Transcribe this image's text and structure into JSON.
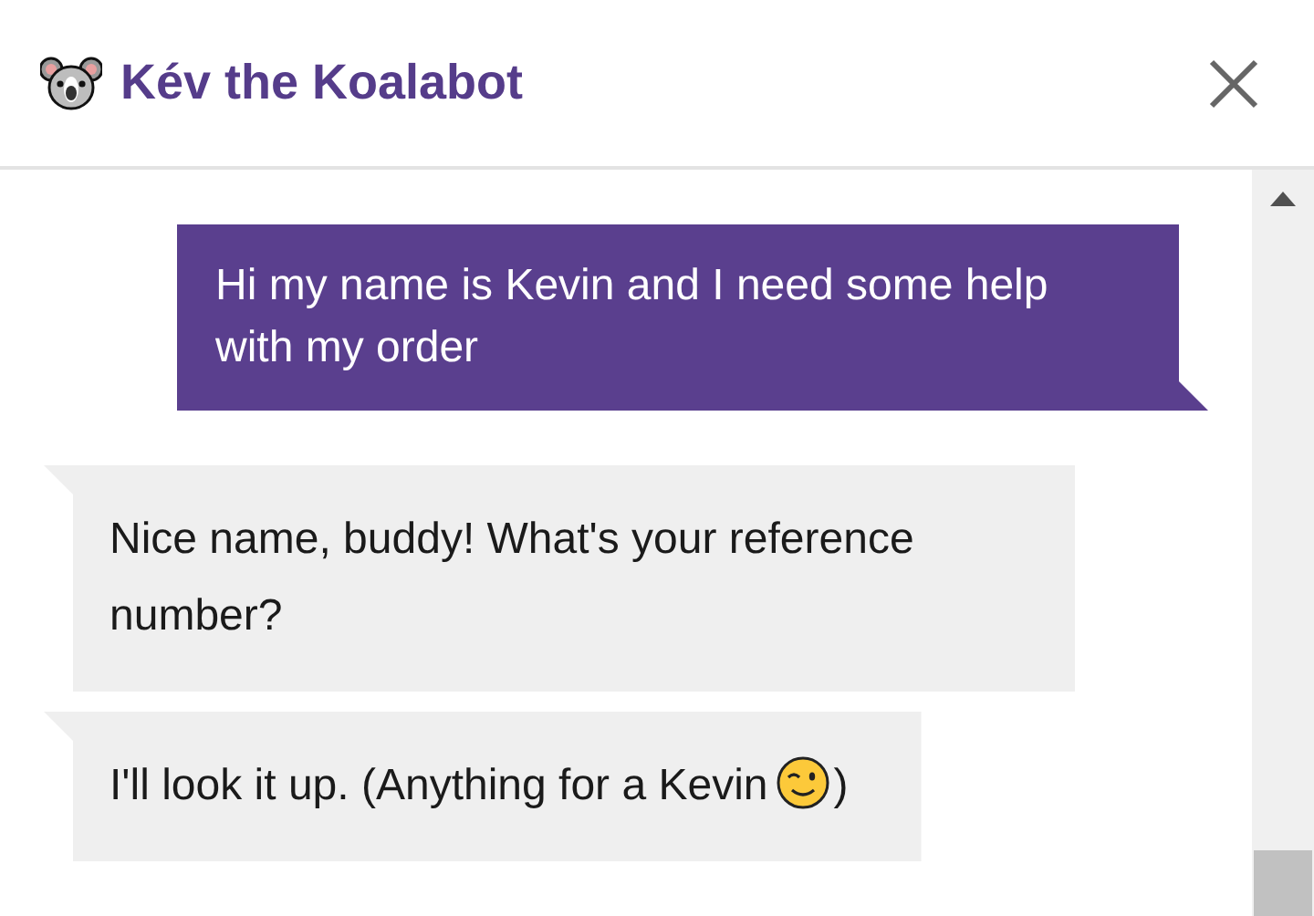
{
  "header": {
    "title": "Kév the Koalabot"
  },
  "messages": [
    {
      "kind": "user",
      "segments": [
        {
          "kind": "text",
          "text": "Hi my name is Kevin and I need some help with my order"
        }
      ]
    },
    {
      "kind": "bot",
      "segments": [
        {
          "kind": "text",
          "text": "Nice name, buddy! What's your reference number?"
        }
      ]
    },
    {
      "kind": "bot",
      "segments": [
        {
          "kind": "text",
          "text": "I'll look it up. (Anything for a Kevin"
        },
        {
          "kind": "wink-emoji"
        },
        {
          "kind": "text",
          "text": ")"
        }
      ]
    }
  ]
}
